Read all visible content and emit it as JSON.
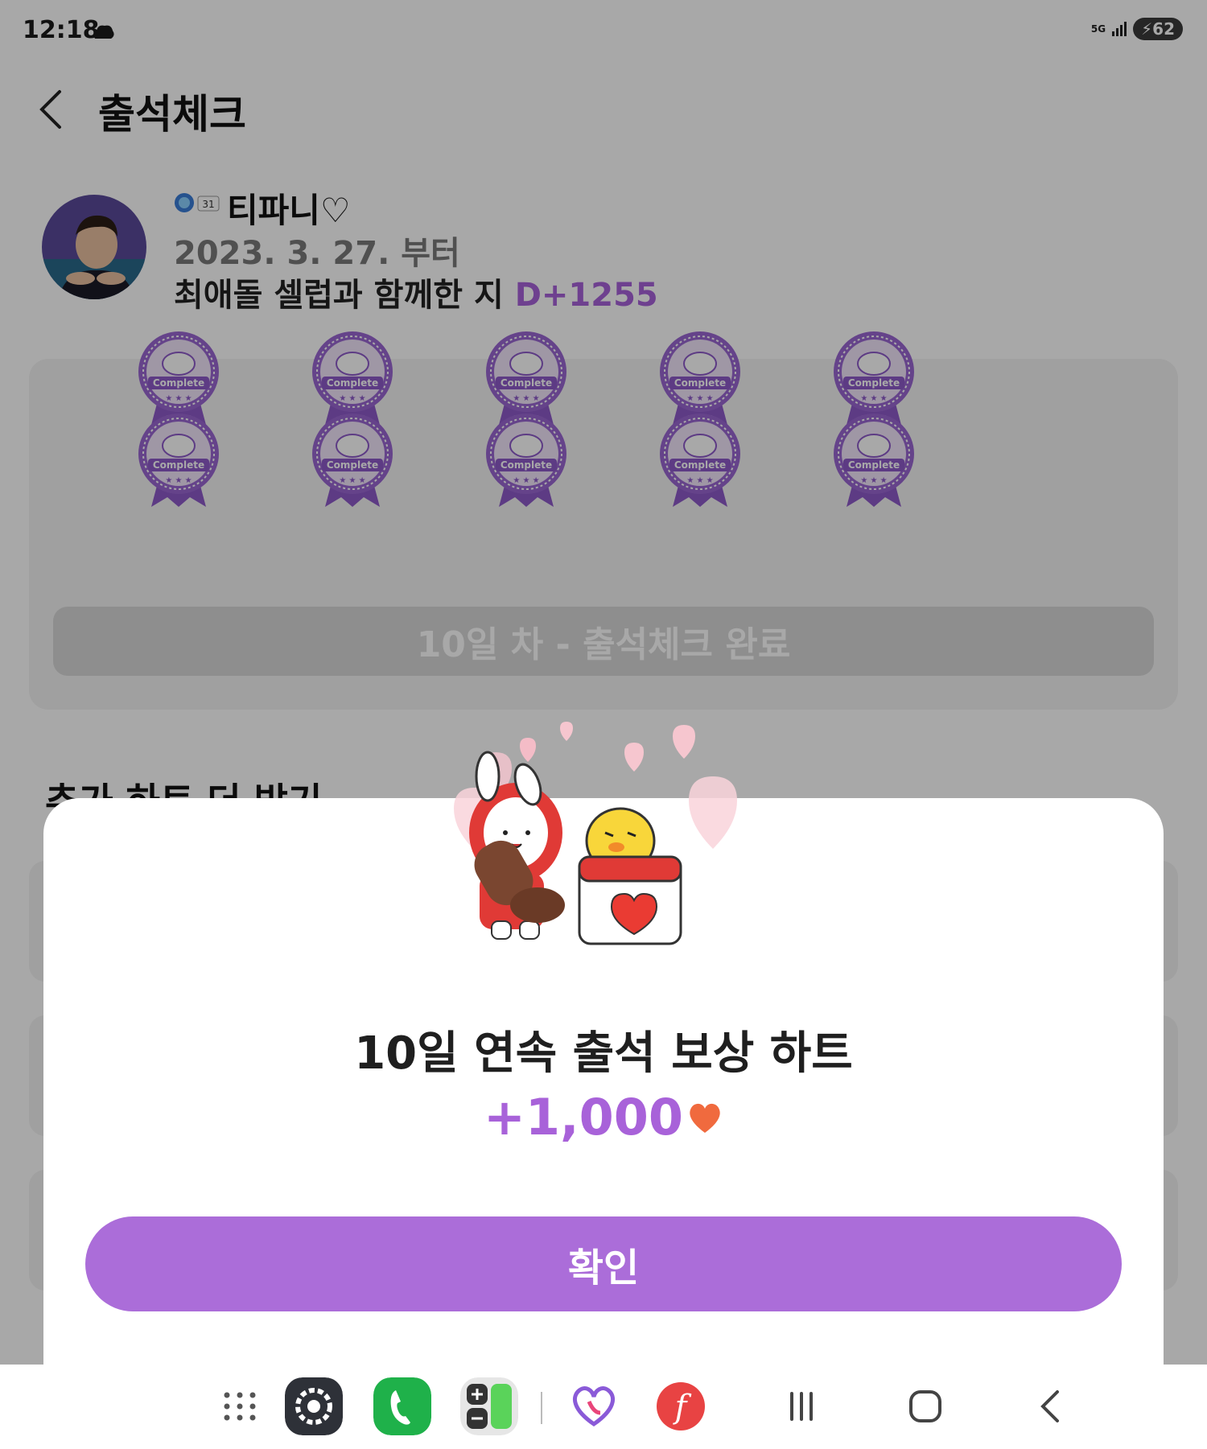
{
  "status_bar": {
    "time": "12:18",
    "network": "5G",
    "battery": "62"
  },
  "header": {
    "title": "출석체크"
  },
  "profile": {
    "level": "31",
    "nickname": "티파니♡",
    "since": "2023. 3. 27. 부터",
    "dday_text": "최애돌 셀럽과 함께한 지 ",
    "dday_value": "D+1255"
  },
  "attendance": {
    "stamp_label": "Complete",
    "stamps_completed": 10,
    "button_label": "10일 차 - 출석체크 완료"
  },
  "more_section": {
    "title": "추가 하트 더 받기"
  },
  "reward_dialog": {
    "title": "10일 연속 출석 보상 하트",
    "amount": "+1,000",
    "confirm_label": "확인"
  },
  "colors": {
    "accent": "#ab6dd9",
    "amount": "#a862d9"
  },
  "dock": {
    "icons": [
      "apps-grid-icon",
      "settings-icon",
      "phone-icon",
      "calculator-icon",
      "heart-app-icon",
      "f-app-icon"
    ]
  },
  "nav": {
    "buttons": [
      "recent-apps-icon",
      "home-icon",
      "back-icon"
    ]
  }
}
